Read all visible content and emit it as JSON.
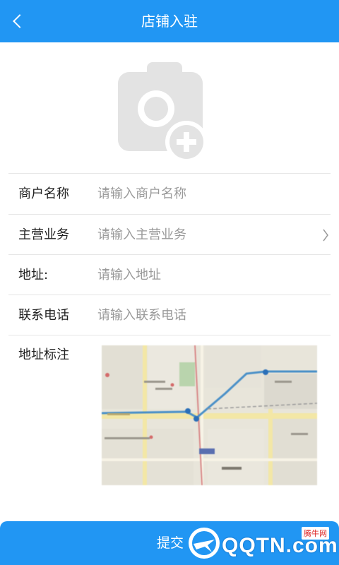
{
  "header": {
    "title": "店铺入驻",
    "back_icon": "chevron-left-icon"
  },
  "photo": {
    "icon": "camera-add-icon"
  },
  "form": {
    "rows": [
      {
        "label": "商户名称",
        "placeholder": "请输入商户名称"
      },
      {
        "label": "主营业务",
        "placeholder": "请输入主营业务",
        "has_chevron": true
      },
      {
        "label": "地址:",
        "placeholder": "请输入地址"
      },
      {
        "label": "联系电话",
        "placeholder": "请输入联系电话"
      }
    ],
    "map_label": "地址标注"
  },
  "submit": {
    "label": "提交"
  },
  "watermark": {
    "text": "QQTN.com",
    "tag": "腾牛网"
  },
  "colors": {
    "primary": "#2196F3",
    "divider": "#e6e6e6",
    "placeholder": "#9a9a9a"
  }
}
